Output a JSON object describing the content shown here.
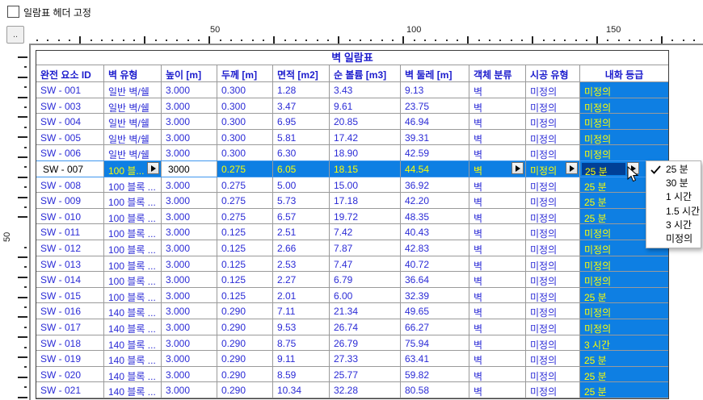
{
  "controls": {
    "header_fix_checkbox": {
      "label": "일람표 헤더 고정",
      "checked": false
    },
    "corner_button_label": ".."
  },
  "rulers": {
    "horizontal_labels": [
      "50",
      "100",
      "150"
    ],
    "vertical_label": "50"
  },
  "table": {
    "title": "벽 일람표",
    "columns": [
      {
        "key": "id",
        "label": "완전 요소 ID"
      },
      {
        "key": "type",
        "label": "벽 유형"
      },
      {
        "key": "height",
        "label": "높이 [m]"
      },
      {
        "key": "thickness",
        "label": "두께 [m]"
      },
      {
        "key": "area",
        "label": "면적 [m2]"
      },
      {
        "key": "volume",
        "label": "순 볼륨 [m3]"
      },
      {
        "key": "perimeter",
        "label": "벽 둘레 [m]"
      },
      {
        "key": "category",
        "label": "객체 분류"
      },
      {
        "key": "construction",
        "label": "시공 유형"
      },
      {
        "key": "fire",
        "label": "내화 등급"
      }
    ],
    "rows": [
      {
        "id": "SW - 001",
        "type": "일반 벽/쉘",
        "height": "3.000",
        "thickness": "0.300",
        "area": "1.28",
        "volume": "3.43",
        "perimeter": "9.13",
        "category": "벽",
        "construction": "미정의",
        "fire": "미정의"
      },
      {
        "id": "SW - 003",
        "type": "일반 벽/쉘",
        "height": "3.000",
        "thickness": "0.300",
        "area": "3.47",
        "volume": "9.61",
        "perimeter": "23.75",
        "category": "벽",
        "construction": "미정의",
        "fire": "미정의"
      },
      {
        "id": "SW - 004",
        "type": "일반 벽/쉘",
        "height": "3.000",
        "thickness": "0.300",
        "area": "6.95",
        "volume": "20.85",
        "perimeter": "46.94",
        "category": "벽",
        "construction": "미정의",
        "fire": "미정의"
      },
      {
        "id": "SW - 005",
        "type": "일반 벽/쉘",
        "height": "3.000",
        "thickness": "0.300",
        "area": "5.81",
        "volume": "17.42",
        "perimeter": "39.31",
        "category": "벽",
        "construction": "미정의",
        "fire": "미정의"
      },
      {
        "id": "SW - 006",
        "type": "일반 벽/쉘",
        "height": "3.000",
        "thickness": "0.300",
        "area": "6.30",
        "volume": "18.90",
        "perimeter": "42.59",
        "category": "벽",
        "construction": "미정의",
        "fire": "미정의"
      },
      {
        "id": "SW - 007",
        "type": "100 블...",
        "height": "3000",
        "thickness": "0.275",
        "area": "6.05",
        "volume": "18.15",
        "perimeter": "44.54",
        "category": "벽",
        "construction": "미정의",
        "fire": "25 분",
        "selected": true
      },
      {
        "id": "SW - 008",
        "type": "100 블록 ...",
        "height": "3.000",
        "thickness": "0.275",
        "area": "5.00",
        "volume": "15.00",
        "perimeter": "36.92",
        "category": "벽",
        "construction": "미정의",
        "fire": "25 분"
      },
      {
        "id": "SW - 009",
        "type": "100 블록 ...",
        "height": "3.000",
        "thickness": "0.275",
        "area": "5.73",
        "volume": "17.18",
        "perimeter": "42.20",
        "category": "벽",
        "construction": "미정의",
        "fire": "25 분"
      },
      {
        "id": "SW - 010",
        "type": "100 블록 ...",
        "height": "3.000",
        "thickness": "0.275",
        "area": "6.57",
        "volume": "19.72",
        "perimeter": "48.35",
        "category": "벽",
        "construction": "미정의",
        "fire": "25 분"
      },
      {
        "id": "SW - 011",
        "type": "100 블록 ...",
        "height": "3.000",
        "thickness": "0.125",
        "area": "2.51",
        "volume": "7.42",
        "perimeter": "40.43",
        "category": "벽",
        "construction": "미정의",
        "fire": "미정의"
      },
      {
        "id": "SW - 012",
        "type": "100 블록 ...",
        "height": "3.000",
        "thickness": "0.125",
        "area": "2.66",
        "volume": "7.87",
        "perimeter": "42.83",
        "category": "벽",
        "construction": "미정의",
        "fire": "미정의"
      },
      {
        "id": "SW - 013",
        "type": "100 블록 ...",
        "height": "3.000",
        "thickness": "0.125",
        "area": "2.53",
        "volume": "7.47",
        "perimeter": "40.72",
        "category": "벽",
        "construction": "미정의",
        "fire": "미정의"
      },
      {
        "id": "SW - 014",
        "type": "100 블록 ...",
        "height": "3.000",
        "thickness": "0.125",
        "area": "2.27",
        "volume": "6.79",
        "perimeter": "36.64",
        "category": "벽",
        "construction": "미정의",
        "fire": "미정의"
      },
      {
        "id": "SW - 015",
        "type": "100 블록 ...",
        "height": "3.000",
        "thickness": "0.125",
        "area": "2.01",
        "volume": "6.00",
        "perimeter": "32.39",
        "category": "벽",
        "construction": "미정의",
        "fire": "25 분"
      },
      {
        "id": "SW - 016",
        "type": "140 블록 ...",
        "height": "3.000",
        "thickness": "0.290",
        "area": "7.11",
        "volume": "21.34",
        "perimeter": "49.65",
        "category": "벽",
        "construction": "미정의",
        "fire": "미정의"
      },
      {
        "id": "SW - 017",
        "type": "140 블록 ...",
        "height": "3.000",
        "thickness": "0.290",
        "area": "9.53",
        "volume": "26.74",
        "perimeter": "66.27",
        "category": "벽",
        "construction": "미정의",
        "fire": "미정의"
      },
      {
        "id": "SW - 018",
        "type": "140 블록 ...",
        "height": "3.000",
        "thickness": "0.290",
        "area": "8.75",
        "volume": "26.79",
        "perimeter": "75.94",
        "category": "벽",
        "construction": "미정의",
        "fire": "3 시간"
      },
      {
        "id": "SW - 019",
        "type": "140 블록 ...",
        "height": "3.000",
        "thickness": "0.290",
        "area": "9.11",
        "volume": "27.33",
        "perimeter": "63.41",
        "category": "벽",
        "construction": "미정의",
        "fire": "25 분"
      },
      {
        "id": "SW - 020",
        "type": "140 블록 ...",
        "height": "3.000",
        "thickness": "0.290",
        "area": "8.59",
        "volume": "25.77",
        "perimeter": "59.82",
        "category": "벽",
        "construction": "미정의",
        "fire": "25 분"
      },
      {
        "id": "SW - 021",
        "type": "140 블록 ...",
        "height": "3.000",
        "thickness": "0.290",
        "area": "10.34",
        "volume": "32.28",
        "perimeter": "80.58",
        "category": "벽",
        "construction": "미정의",
        "fire": "25 분"
      }
    ],
    "selected_row_id": "SW - 007"
  },
  "dropdown": {
    "items": [
      {
        "label": "25 분",
        "checked": true
      },
      {
        "label": "30 분",
        "checked": false
      },
      {
        "label": "1 시간",
        "checked": false
      },
      {
        "label": "1.5 시간",
        "checked": false
      },
      {
        "label": "3 시간",
        "checked": false
      },
      {
        "label": "미정의",
        "checked": false
      }
    ]
  },
  "colors": {
    "selection_blue": "#0e7fe3",
    "focused_field_navy": "#003f96",
    "highlight_text_yellow": "#ffff00",
    "data_text_blue": "#2b2bd6",
    "header_text_blue": "#1c1ccd",
    "grid_line_gray": "#9a9a9a"
  }
}
